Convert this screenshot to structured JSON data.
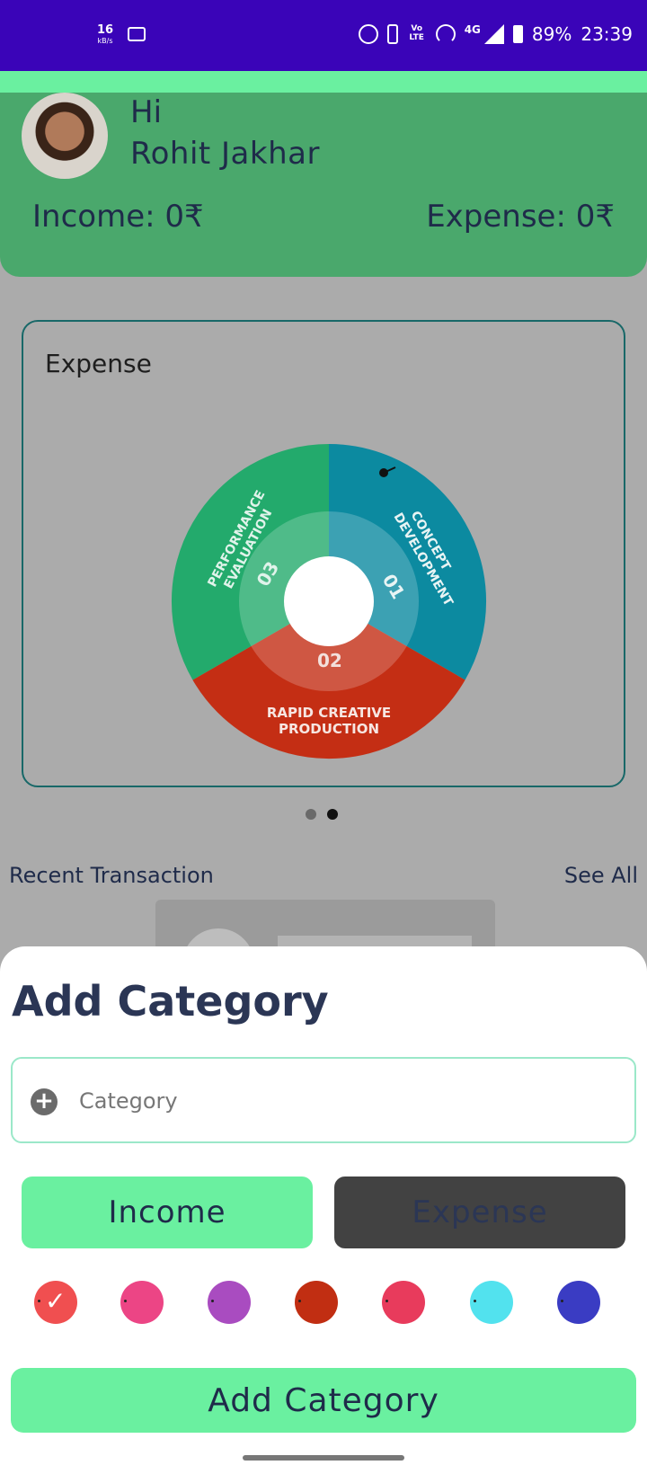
{
  "status_bar": {
    "net_speed": "16",
    "net_unit": "kB/s",
    "volte_label": "Vo LTE",
    "network": "4G",
    "battery": "89%",
    "time": "23:39"
  },
  "header": {
    "greeting": "Hi",
    "user_name": "Rohit Jakhar",
    "income_label": "Income: 0₹",
    "expense_label": "Expense: 0₹"
  },
  "chart_card": {
    "title": "Expense",
    "segments": [
      {
        "number": "01",
        "label_line1": "CONCEPT",
        "label_line2": "DEVELOPMENT",
        "color": "#0c8aa0"
      },
      {
        "number": "02",
        "label_line1": "RAPID CREATIVE",
        "label_line2": "PRODUCTION",
        "color": "#c42e14"
      },
      {
        "number": "03",
        "label_line1": "PERFORMANCE",
        "label_line2": "EVALUATION",
        "color": "#23aa6c"
      }
    ]
  },
  "pager": {
    "count": 2,
    "active_index": 1
  },
  "recent": {
    "title": "Recent Transaction",
    "see_all": "See All"
  },
  "sheet": {
    "title": "Add Category",
    "category_placeholder": "Category",
    "category_value": "",
    "income_label": "Income",
    "expense_label": "Expense",
    "selected_type": "Income",
    "colors": [
      "#f04f50",
      "#ec4585",
      "#a94cc0",
      "#c12e12",
      "#e83b5c",
      "#52e2ee",
      "#3a3cc3"
    ],
    "selected_color_index": 0,
    "submit_label": "Add Category"
  },
  "accent_colors": {
    "status_bar": "#3a04b8",
    "header": "#4aa86c",
    "mint": "#6af0a0",
    "text_dark": "#1f2b4a"
  }
}
